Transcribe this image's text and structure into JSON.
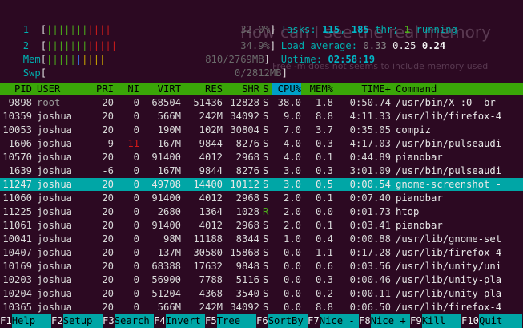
{
  "meters": {
    "cpu1": {
      "label": "1",
      "value": "32.0%",
      "fill": 0.32
    },
    "cpu2": {
      "label": "2",
      "value": "34.9%",
      "fill": 0.349
    },
    "mem": {
      "label": "Mem",
      "value": "810/2769MB",
      "fill": 0.29
    },
    "swp": {
      "label": "Swp",
      "value": "0/2812MB",
      "fill": 0.0
    }
  },
  "stats": {
    "tasks_label": "Tasks:",
    "tasks": "115",
    "threads": "185",
    "threads_label": "thr;",
    "running": "1",
    "running_label": "running",
    "load_label": "Load average:",
    "load1": "0.33",
    "load5": "0.25",
    "load15": "0.24",
    "uptime_label": "Uptime:",
    "uptime": "02:58:19"
  },
  "background": {
    "title": "How can I see the real memory",
    "line": "Free -m does not seems to include memory used"
  },
  "columns": [
    "PID",
    "USER",
    "PRI",
    "NI",
    "VIRT",
    "RES",
    "SHR",
    "S",
    "CPU%",
    "MEM%",
    "TIME+",
    "Command"
  ],
  "processes": [
    {
      "pid": "9898",
      "user": "root",
      "pri": "20",
      "ni": "0",
      "virt": "68504",
      "res": "51436",
      "shr": "12828",
      "s": "S",
      "cpu": "38.0",
      "mem": "1.8",
      "time": "0:50.74",
      "cmd": "/usr/bin/X :0 -br"
    },
    {
      "pid": "10359",
      "user": "joshua",
      "pri": "20",
      "ni": "0",
      "virt": "566M",
      "res": "242M",
      "shr": "34092",
      "s": "S",
      "cpu": "9.0",
      "mem": "8.8",
      "time": "4:11.33",
      "cmd": "/usr/lib/firefox-4"
    },
    {
      "pid": "10053",
      "user": "joshua",
      "pri": "20",
      "ni": "0",
      "virt": "190M",
      "res": "102M",
      "shr": "30804",
      "s": "S",
      "cpu": "7.0",
      "mem": "3.7",
      "time": "0:35.05",
      "cmd": "compiz"
    },
    {
      "pid": "1606",
      "user": "joshua",
      "pri": "9",
      "ni": "-11",
      "virt": "167M",
      "res": "9844",
      "shr": "8276",
      "s": "S",
      "cpu": "4.0",
      "mem": "0.3",
      "time": "4:17.03",
      "cmd": "/usr/bin/pulseaudi"
    },
    {
      "pid": "10570",
      "user": "joshua",
      "pri": "20",
      "ni": "0",
      "virt": "91400",
      "res": "4012",
      "shr": "2968",
      "s": "S",
      "cpu": "4.0",
      "mem": "0.1",
      "time": "0:44.89",
      "cmd": "pianobar"
    },
    {
      "pid": "1639",
      "user": "joshua",
      "pri": "-6",
      "ni": "0",
      "virt": "167M",
      "res": "9844",
      "shr": "8276",
      "s": "S",
      "cpu": "3.0",
      "mem": "0.3",
      "time": "3:01.09",
      "cmd": "/usr/bin/pulseaudi"
    },
    {
      "pid": "11247",
      "user": "joshua",
      "pri": "20",
      "ni": "0",
      "virt": "49708",
      "res": "14400",
      "shr": "10112",
      "s": "S",
      "cpu": "3.0",
      "mem": "0.5",
      "time": "0:00.54",
      "cmd": "gnome-screenshot -",
      "selected": true
    },
    {
      "pid": "11060",
      "user": "joshua",
      "pri": "20",
      "ni": "0",
      "virt": "91400",
      "res": "4012",
      "shr": "2968",
      "s": "S",
      "cpu": "2.0",
      "mem": "0.1",
      "time": "0:07.40",
      "cmd": "pianobar"
    },
    {
      "pid": "11225",
      "user": "joshua",
      "pri": "20",
      "ni": "0",
      "virt": "2680",
      "res": "1364",
      "shr": "1028",
      "s": "R",
      "cpu": "2.0",
      "mem": "0.0",
      "time": "0:01.73",
      "cmd": "htop"
    },
    {
      "pid": "11061",
      "user": "joshua",
      "pri": "20",
      "ni": "0",
      "virt": "91400",
      "res": "4012",
      "shr": "2968",
      "s": "S",
      "cpu": "2.0",
      "mem": "0.1",
      "time": "0:03.41",
      "cmd": "pianobar"
    },
    {
      "pid": "10041",
      "user": "joshua",
      "pri": "20",
      "ni": "0",
      "virt": "98M",
      "res": "11188",
      "shr": "8344",
      "s": "S",
      "cpu": "1.0",
      "mem": "0.4",
      "time": "0:00.88",
      "cmd": "/usr/lib/gnome-set"
    },
    {
      "pid": "10407",
      "user": "joshua",
      "pri": "20",
      "ni": "0",
      "virt": "137M",
      "res": "30580",
      "shr": "15868",
      "s": "S",
      "cpu": "0.0",
      "mem": "1.1",
      "time": "0:17.28",
      "cmd": "/usr/lib/firefox-4"
    },
    {
      "pid": "10169",
      "user": "joshua",
      "pri": "20",
      "ni": "0",
      "virt": "68388",
      "res": "17632",
      "shr": "9848",
      "s": "S",
      "cpu": "0.0",
      "mem": "0.6",
      "time": "0:03.56",
      "cmd": "/usr/lib/unity/uni"
    },
    {
      "pid": "10203",
      "user": "joshua",
      "pri": "20",
      "ni": "0",
      "virt": "56900",
      "res": "7788",
      "shr": "5116",
      "s": "S",
      "cpu": "0.0",
      "mem": "0.3",
      "time": "0:00.46",
      "cmd": "/usr/lib/unity-pla"
    },
    {
      "pid": "10204",
      "user": "joshua",
      "pri": "20",
      "ni": "0",
      "virt": "51204",
      "res": "4368",
      "shr": "3540",
      "s": "S",
      "cpu": "0.0",
      "mem": "0.2",
      "time": "0:00.11",
      "cmd": "/usr/lib/unity-pla"
    },
    {
      "pid": "10365",
      "user": "joshua",
      "pri": "20",
      "ni": "0",
      "virt": "566M",
      "res": "242M",
      "shr": "34092",
      "s": "S",
      "cpu": "0.0",
      "mem": "8.8",
      "time": "0:06.50",
      "cmd": "/usr/lib/firefox-4"
    }
  ],
  "fkeys": [
    {
      "key": "F1",
      "label": "Help"
    },
    {
      "key": "F2",
      "label": "Setup"
    },
    {
      "key": "F3",
      "label": "Search"
    },
    {
      "key": "F4",
      "label": "Invert"
    },
    {
      "key": "F5",
      "label": "Tree"
    },
    {
      "key": "F6",
      "label": "SortBy"
    },
    {
      "key": "F7",
      "label": "Nice -"
    },
    {
      "key": "F8",
      "label": "Nice +"
    },
    {
      "key": "F9",
      "label": "Kill"
    },
    {
      "key": "F10",
      "label": "Quit"
    }
  ],
  "colors": {
    "background": "#2c0922",
    "header": "#3aa608",
    "selection": "#00a6a6",
    "label": "#00b0b0"
  }
}
